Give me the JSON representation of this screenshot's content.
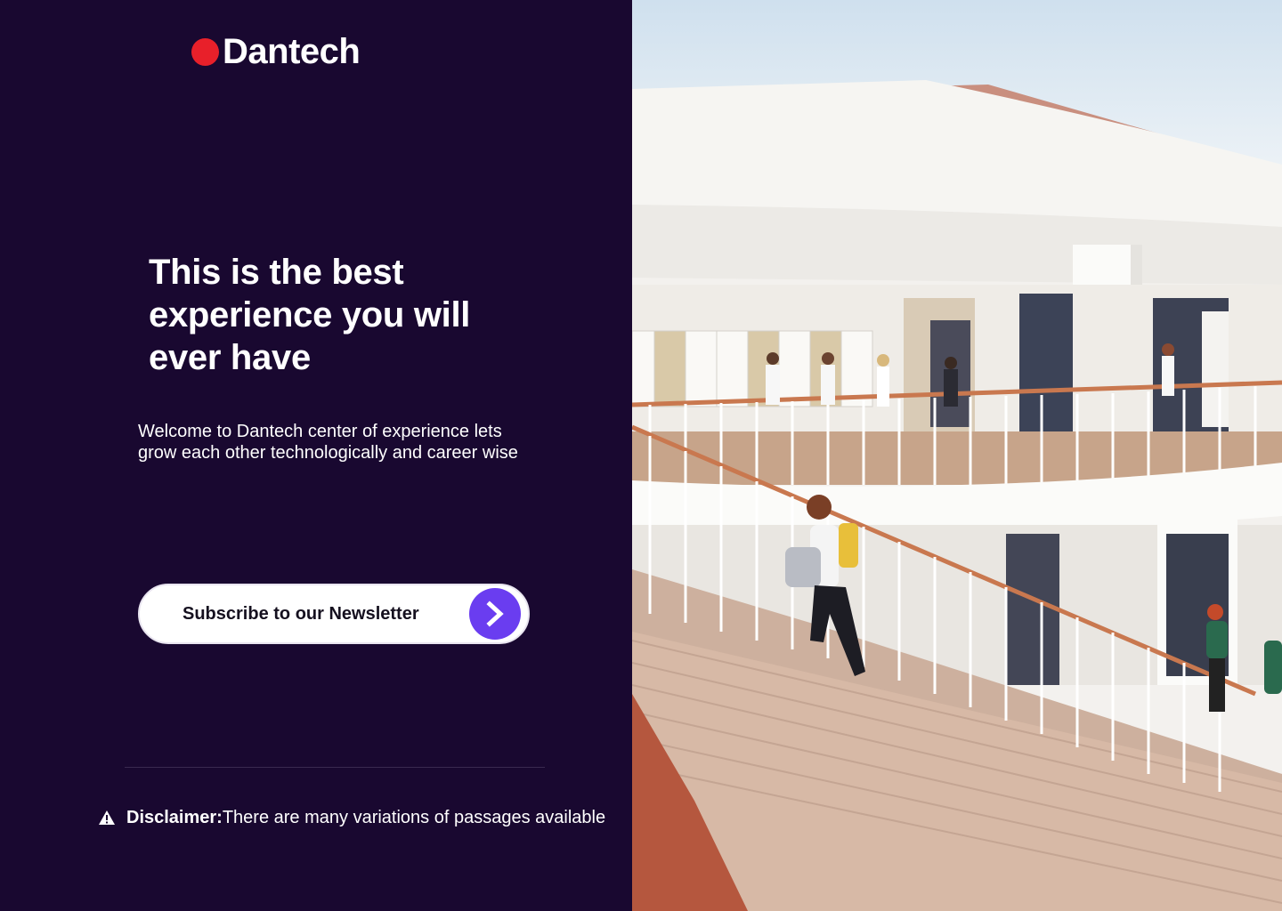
{
  "brand": {
    "name": "Dantech",
    "dot_color": "#e8202a"
  },
  "hero": {
    "headline": "This is the best experience you will ever have",
    "intro": "Welcome to Dantech center of experience lets grow each other technologically and career wise"
  },
  "newsletter": {
    "label": "Subscribe to our Newsletter",
    "button_icon": "chevron-right-icon",
    "accent": "#6a3df0"
  },
  "disclaimer": {
    "icon": "warning-icon",
    "title": "Disclaimer:",
    "text": "There are many variations of passages available"
  },
  "colors": {
    "background": "#190830",
    "text": "#ffffff"
  }
}
